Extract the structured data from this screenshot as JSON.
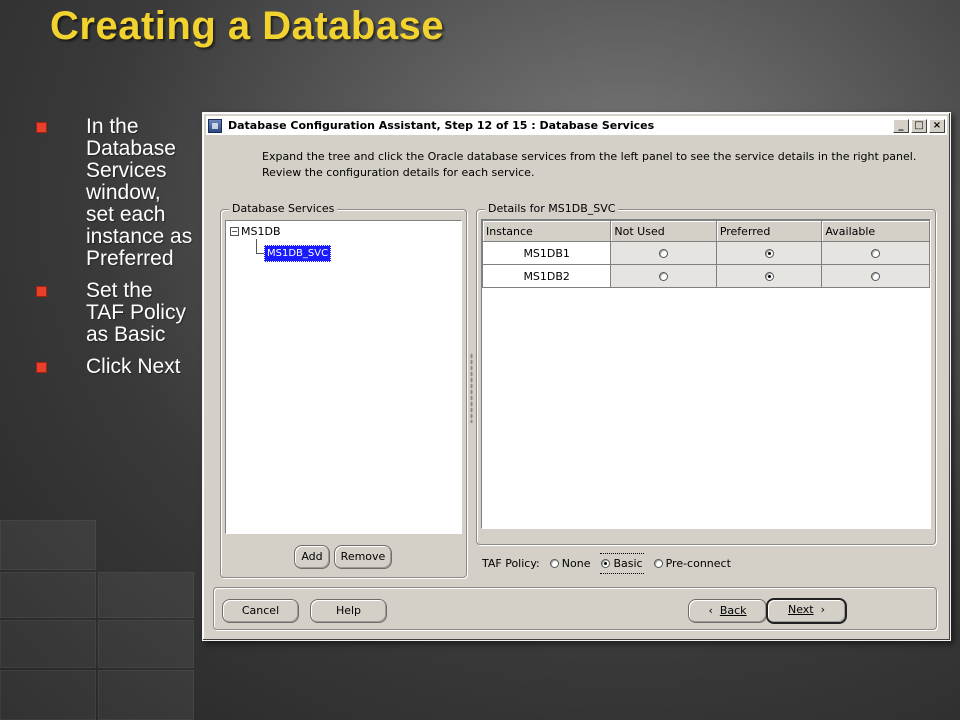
{
  "slide": {
    "title": "Creating a Database",
    "bullets": [
      "In the Database Services window, set each instance as Preferred",
      "Set the TAF Policy as Basic",
      "Click Next"
    ]
  },
  "dialog": {
    "title": "Database Configuration Assistant, Step 12 of 15 : Database Services",
    "window_buttons": [
      "_",
      "□",
      "×"
    ],
    "instructions_line1": "Expand the tree and click the Oracle database services from the left panel to see the service details in the right panel.",
    "instructions_line2": "Review the configuration details for each service.",
    "services_group": {
      "legend": "Database Services",
      "root": "MS1DB",
      "child": "MS1DB_SVC",
      "add_label": "Add",
      "remove_label": "Remove"
    },
    "details_group": {
      "legend": "Details for MS1DB_SVC",
      "columns": [
        "Instance",
        "Not Used",
        "Preferred",
        "Available"
      ],
      "rows": [
        {
          "instance": "MS1DB1",
          "selected": "Preferred"
        },
        {
          "instance": "MS1DB2",
          "selected": "Preferred"
        }
      ],
      "taf_label": "TAF Policy:",
      "taf_options": [
        "None",
        "Basic",
        "Pre-connect"
      ],
      "taf_selected": "Basic"
    },
    "buttons": {
      "cancel": "Cancel",
      "help": "Help",
      "back": "Back",
      "next": "Next"
    }
  },
  "icons": [
    "app-icon",
    "minimize-icon",
    "maximize-icon",
    "close-icon",
    "tree-collapse-icon",
    "back-arrow-icon",
    "next-arrow-icon",
    "bullet-square-icon"
  ],
  "colors": {
    "title": "#f2d22e",
    "bullet": "#e8402a",
    "selection": "#1a1aff",
    "dialog_bg": "#d4d0c8"
  }
}
